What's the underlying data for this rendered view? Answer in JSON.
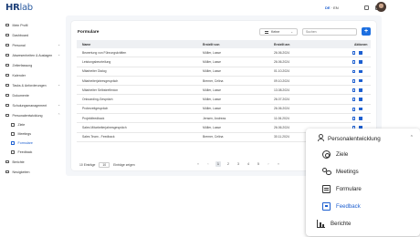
{
  "app": {
    "logo_main": "HR",
    "logo_sub": "lab",
    "language": {
      "active": "DE",
      "separator": " · ",
      "other": "EN"
    }
  },
  "sidebar": {
    "items": [
      {
        "label": "Mein Profil",
        "icon": "user-icon"
      },
      {
        "label": "Dashboard",
        "icon": "dashboard-icon"
      },
      {
        "label": "Personal",
        "icon": "people-icon",
        "expandable": true
      },
      {
        "label": "Abwesenheiten & Auslagen",
        "icon": "calendar-icon",
        "expandable": true
      },
      {
        "label": "Zeiterfassung",
        "icon": "clock-icon"
      },
      {
        "label": "Kalender",
        "icon": "calendar-icon"
      },
      {
        "label": "Tasks & Anforderungen",
        "icon": "tasks-icon",
        "expandable": true
      },
      {
        "label": "Dokumente",
        "icon": "document-icon"
      },
      {
        "label": "Schulungsmanagement",
        "icon": "training-icon",
        "expandable": true
      },
      {
        "label": "Personalentwicklung",
        "icon": "people-icon",
        "expandable": true,
        "expanded": true
      }
    ],
    "sub_items": [
      {
        "label": "Ziele",
        "icon": "target-icon"
      },
      {
        "label": "Meetings",
        "icon": "meetings-icon"
      },
      {
        "label": "Formulare",
        "icon": "form-icon",
        "active": true
      },
      {
        "label": "Feedback",
        "icon": "feedback-icon"
      }
    ],
    "tail_items": [
      {
        "label": "Berichte",
        "icon": "chart-icon"
      },
      {
        "label": "Neuigkeiten",
        "icon": "news-icon"
      }
    ]
  },
  "page": {
    "title": "Formulare",
    "filter_label": "Keine",
    "search_placeholder": "Suchen",
    "add_label": "+"
  },
  "table": {
    "columns": [
      "Name",
      "Erstellt von",
      "Erstellt am",
      "Aktionen"
    ],
    "rows": [
      {
        "name": "Bewertung von Führungskräften",
        "by": "Müller, Lasse",
        "date": "26.06.2024"
      },
      {
        "name": "Leistungsbeurteilung",
        "by": "Müller, Lasse",
        "date": "26.06.2024"
      },
      {
        "name": "Mitarbeiter Dialog",
        "by": "Müller, Lasse",
        "date": "01.10.2024"
      },
      {
        "name": "Mitarbeiterjahresgespräch",
        "by": "Bremer, Celina",
        "date": "09.10.2024"
      },
      {
        "name": "Mitarbeiter Selbstreflexion",
        "by": "Müller, Lasse",
        "date": "13.08.2024"
      },
      {
        "name": "Onboarding-Gespräch",
        "by": "Müller, Lasse",
        "date": "26.07.2024"
      },
      {
        "name": "Probezeitgespräch",
        "by": "Müller, Lasse",
        "date": "26.06.2024"
      },
      {
        "name": "Projektfeedback",
        "by": "Jensen, Andreas",
        "date": "11.06.2024"
      },
      {
        "name": "Sales Mitarbeiterjahresgespräch",
        "by": "Müller, Lasse",
        "date": "26.06.2024"
      },
      {
        "name": "Sales Team - Feedback",
        "by": "Bremer, Celina",
        "date": "30.11.2024"
      }
    ]
  },
  "footer": {
    "entries_count": "10 Einträge",
    "page_size": "10",
    "page_size_label": "Einträge zeigen",
    "pages": [
      "1",
      "2",
      "3",
      "4",
      "5"
    ],
    "current_page": "1",
    "first": "«",
    "prev": "‹",
    "next": "›",
    "last": "»"
  },
  "zoom_panel": {
    "header": "Personalentwicklung",
    "items": [
      {
        "label": "Ziele",
        "icon": "target-icon"
      },
      {
        "label": "Meetings",
        "icon": "meetings-icon"
      },
      {
        "label": "Formulare",
        "icon": "form-icon"
      },
      {
        "label": "Feedback",
        "icon": "feedback-icon",
        "active": true
      },
      {
        "label": "Berichte",
        "icon": "chart-icon"
      }
    ]
  },
  "colors": {
    "accent": "#1d6fe0",
    "active_text": "#1d5fd0",
    "content_bg": "#f4f6f9"
  }
}
